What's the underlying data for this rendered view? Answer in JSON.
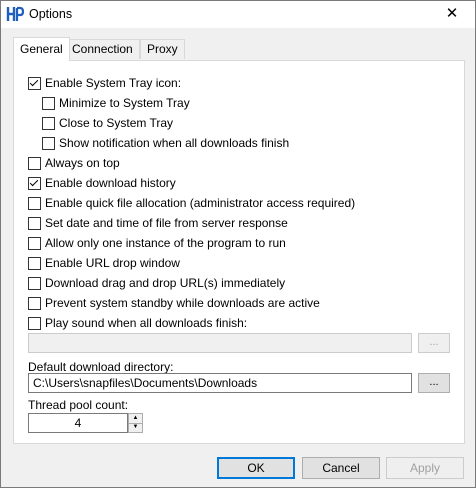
{
  "window": {
    "title": "Options",
    "icon": "hp-app-icon",
    "close_icon": "close-icon",
    "close_glyph": "✕"
  },
  "tabs": [
    {
      "label": "General",
      "active": true
    },
    {
      "label": "Connection",
      "active": false
    },
    {
      "label": "Proxy",
      "active": false
    }
  ],
  "general": {
    "options": [
      {
        "label": "Enable System Tray icon:",
        "checked": true
      },
      {
        "label": "Minimize to System Tray",
        "checked": false
      },
      {
        "label": "Close to System Tray",
        "checked": false
      },
      {
        "label": "Show notification when all downloads finish",
        "checked": false
      },
      {
        "label": "Always on top",
        "checked": false
      },
      {
        "label": "Enable download history",
        "checked": true
      },
      {
        "label": "Enable quick file allocation (administrator access required)",
        "checked": false
      },
      {
        "label": "Set date and time of file from server response",
        "checked": false
      },
      {
        "label": "Allow only one instance of the program to run",
        "checked": false
      },
      {
        "label": "Enable URL drop window",
        "checked": false
      },
      {
        "label": "Download drag and drop URL(s) immediately",
        "checked": false
      },
      {
        "label": "Prevent system standby while downloads are active",
        "checked": false
      },
      {
        "label": "Play sound when all downloads finish:",
        "checked": false
      }
    ],
    "sound_path": "",
    "sound_browse_label": "...",
    "download_dir_label": "Default download directory:",
    "download_dir_value": "C:\\Users\\snapfiles\\Documents\\Downloads",
    "download_browse_label": "...",
    "thread_pool_label": "Thread pool count:",
    "thread_pool_value": "4",
    "spin_up_glyph": "▲",
    "spin_down_glyph": "▼"
  },
  "buttons": {
    "ok": "OK",
    "cancel": "Cancel",
    "apply": "Apply"
  },
  "colors": {
    "accent": "#0078d7",
    "icon_blue": "#1f5fbf"
  }
}
